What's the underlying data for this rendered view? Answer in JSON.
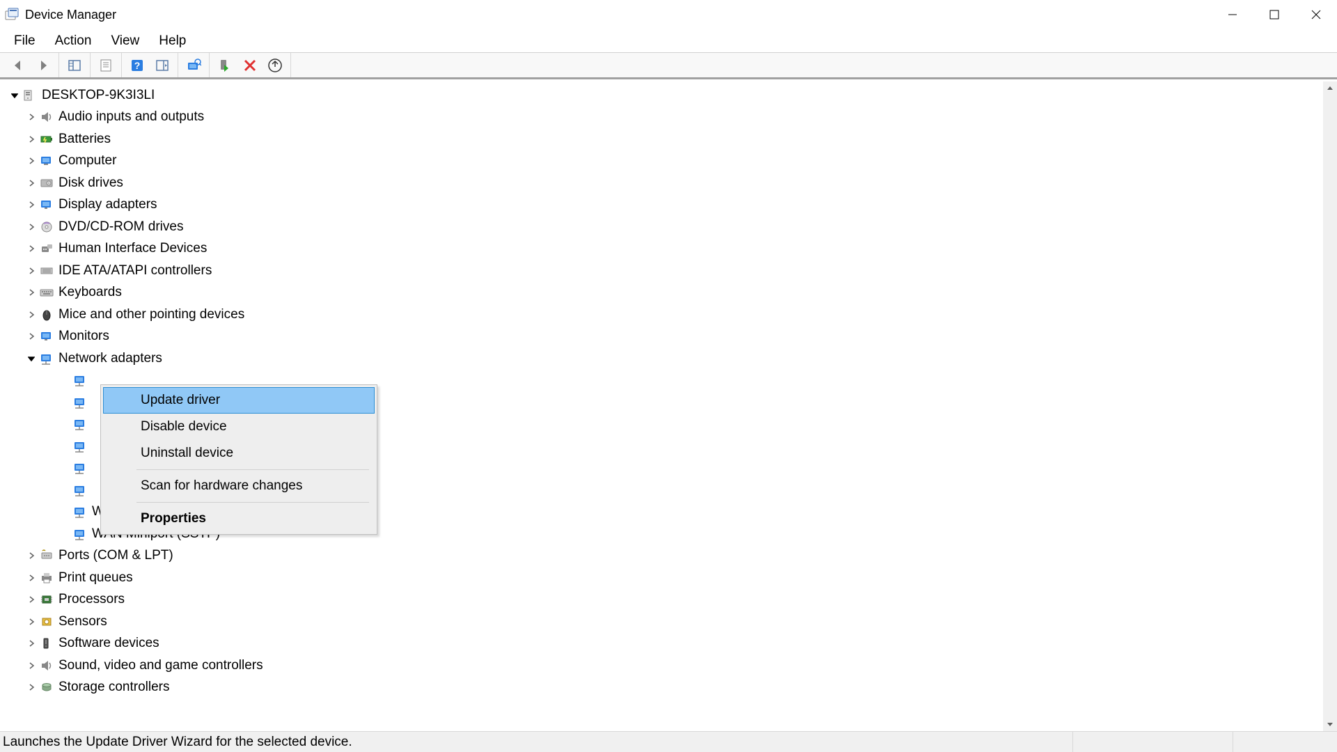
{
  "window": {
    "title": "Device Manager"
  },
  "menus": {
    "file": "File",
    "action": "Action",
    "view": "View",
    "help": "Help"
  },
  "root": {
    "label": "DESKTOP-9K3I3LI"
  },
  "categories": [
    {
      "label": "Audio inputs and outputs",
      "icon": "audio"
    },
    {
      "label": "Batteries",
      "icon": "battery"
    },
    {
      "label": "Computer",
      "icon": "computer"
    },
    {
      "label": "Disk drives",
      "icon": "disk"
    },
    {
      "label": "Display adapters",
      "icon": "display"
    },
    {
      "label": "DVD/CD-ROM drives",
      "icon": "dvd"
    },
    {
      "label": "Human Interface Devices",
      "icon": "hid"
    },
    {
      "label": "IDE ATA/ATAPI controllers",
      "icon": "ide"
    },
    {
      "label": "Keyboards",
      "icon": "keyboard"
    },
    {
      "label": "Mice and other pointing devices",
      "icon": "mouse"
    },
    {
      "label": "Monitors",
      "icon": "monitor"
    },
    {
      "label": "Network adapters",
      "icon": "network",
      "expanded": true
    }
  ],
  "network_devices": [
    {
      "label": ""
    },
    {
      "label": ""
    },
    {
      "label": ""
    },
    {
      "label": ""
    },
    {
      "label": ""
    },
    {
      "label": ""
    },
    {
      "label": "WAN Miniport (PPTP)"
    },
    {
      "label": "WAN Miniport (SSTP)"
    }
  ],
  "categories_after": [
    {
      "label": "Ports (COM & LPT)",
      "icon": "port"
    },
    {
      "label": "Print queues",
      "icon": "printer"
    },
    {
      "label": "Processors",
      "icon": "cpu"
    },
    {
      "label": "Sensors",
      "icon": "sensor"
    },
    {
      "label": "Software devices",
      "icon": "software"
    },
    {
      "label": "Sound, video and game controllers",
      "icon": "sound"
    },
    {
      "label": "Storage controllers",
      "icon": "storage"
    }
  ],
  "context_menu": {
    "update": "Update driver",
    "disable": "Disable device",
    "uninstall": "Uninstall device",
    "scan": "Scan for hardware changes",
    "properties": "Properties"
  },
  "status": "Launches the Update Driver Wizard for the selected device."
}
